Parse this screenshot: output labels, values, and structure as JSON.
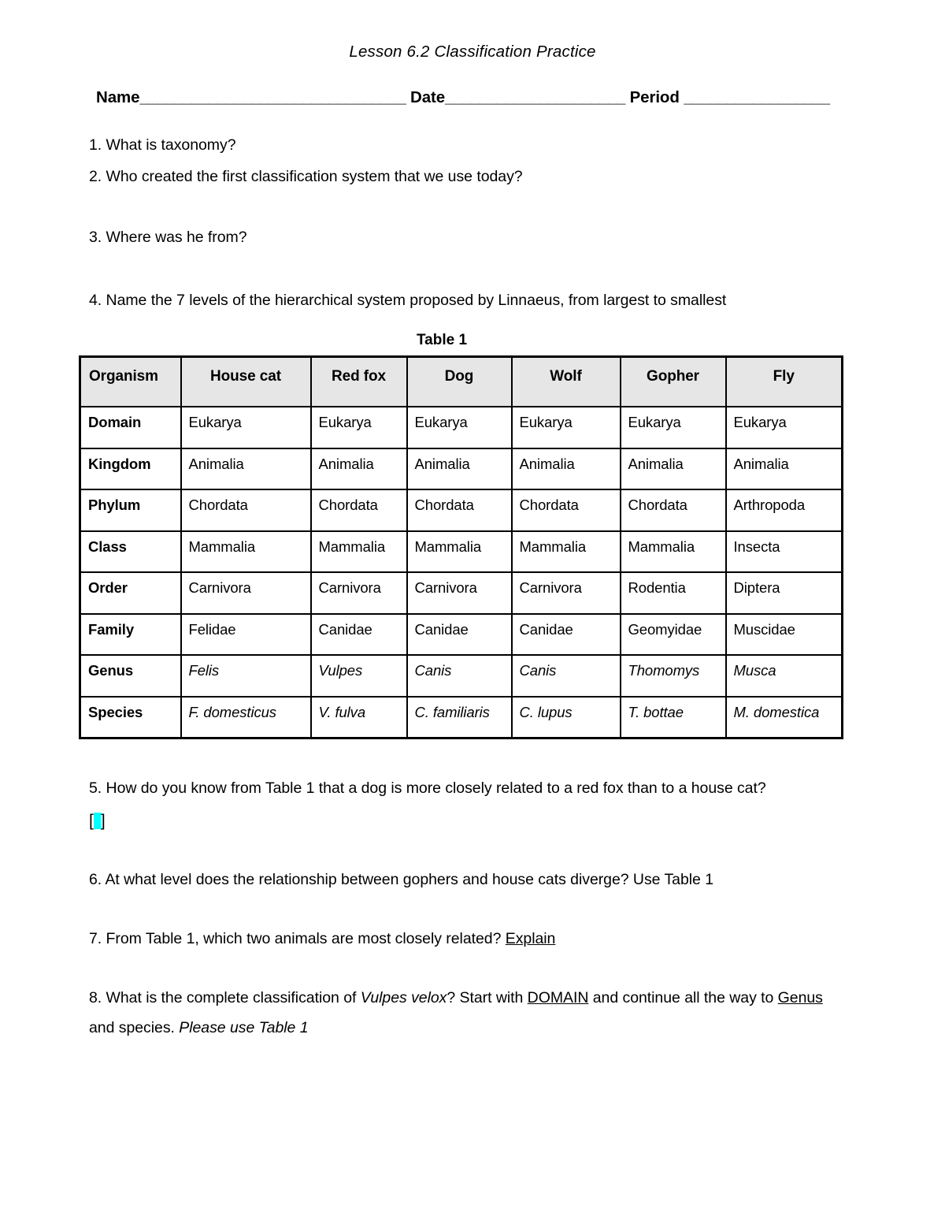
{
  "document": {
    "title": "Lesson 6.2 Classification Practice",
    "header_fields": {
      "name_label": "Name",
      "name_rule": "_______________________________",
      "date_label": "Date",
      "date_rule": "_____________________",
      "period_label": "Period",
      "period_rule": "_________________"
    },
    "questions": [
      {
        "id": "q1",
        "text": "1. What is taxonomy?"
      },
      {
        "id": "q2",
        "text": "2.  Who created the first classification system that we use today?"
      },
      {
        "id": "q3",
        "text": "3. Where was he from?"
      },
      {
        "id": "q4",
        "text": "4.  Name the 7 levels of the hierarchical system proposed by Linnaeus, from largest to smallest"
      },
      {
        "id": "q5",
        "text": "5.  How do you know from Table 1 that a dog is more closely related to a red fox than to a house cat?"
      },
      {
        "id": "q6",
        "text": "6.  At what level does the relationship between gophers and house cats diverge? Use Table 1"
      },
      {
        "id": "q7_part1",
        "text": "7. From Table 1, which two animals are most closely related? "
      },
      {
        "id": "q7_explain",
        "text": "Explain "
      },
      {
        "id": "q8_part1",
        "text": "8.  What is the complete classification of "
      },
      {
        "id": "q8_italic1",
        "text": "Vulpes velox"
      },
      {
        "id": "q8_part2",
        "text": "? Start with "
      },
      {
        "id": "q8_domain",
        "text": "DOMAIN"
      },
      {
        "id": "q8_part3",
        "text": " and continue all the way to "
      },
      {
        "id": "q8_genus",
        "text": "Genus "
      },
      {
        "id": "q8_part4",
        "text": "and species.  "
      },
      {
        "id": "q8_italic2",
        "text": "Please use Table 1"
      }
    ],
    "selection_marker": {
      "open_bracket": "[",
      "close_bracket": "]",
      "highlight_color": "#00ffff"
    },
    "table": {
      "caption": "Table 1",
      "header_bg": "#e6e6e6",
      "columns": [
        "Organism",
        "House cat",
        "Red fox",
        "Dog",
        "Wolf",
        "Gopher",
        "Fly"
      ],
      "rows": [
        {
          "rank": "Domain",
          "italic": false,
          "values": [
            "Eukarya",
            "Eukarya",
            "Eukarya",
            "Eukarya",
            "Eukarya",
            "Eukarya"
          ]
        },
        {
          "rank": "Kingdom",
          "italic": false,
          "values": [
            "Animalia",
            "Animalia",
            "Animalia",
            "Animalia",
            "Animalia",
            "Animalia"
          ]
        },
        {
          "rank": "Phylum",
          "italic": false,
          "values": [
            "Chordata",
            "Chordata",
            "Chordata",
            "Chordata",
            "Chordata",
            "Arthropoda"
          ]
        },
        {
          "rank": "Class",
          "italic": false,
          "values": [
            "Mammalia",
            "Mammalia",
            "Mammalia",
            "Mammalia",
            "Mammalia",
            "Insecta"
          ]
        },
        {
          "rank": "Order",
          "italic": false,
          "values": [
            "Carnivora",
            "Carnivora",
            "Carnivora",
            "Carnivora",
            "Rodentia",
            "Diptera"
          ]
        },
        {
          "rank": "Family",
          "italic": false,
          "values": [
            "Felidae",
            "Canidae",
            "Canidae",
            "Canidae",
            "Geomyidae",
            "Muscidae"
          ]
        },
        {
          "rank": "Genus",
          "italic": true,
          "values": [
            "Felis",
            "Vulpes",
            "Canis",
            "Canis",
            "Thomomys",
            "Musca"
          ]
        },
        {
          "rank": "Species",
          "italic": true,
          "values": [
            "F. domesticus",
            "V. fulva",
            "C. familiaris",
            "C. lupus",
            "T. bottae",
            "M. domestica"
          ]
        }
      ]
    }
  }
}
